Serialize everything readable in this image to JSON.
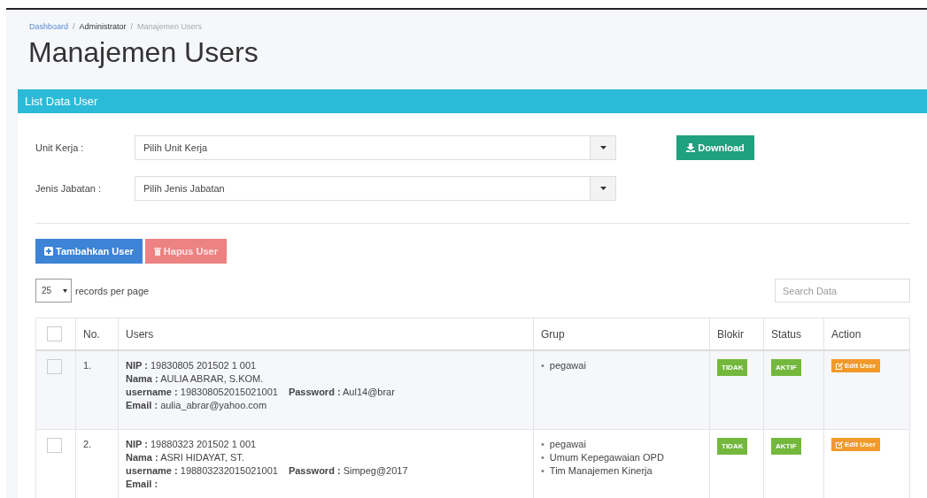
{
  "breadcrumb": {
    "separator": "/",
    "items": [
      {
        "label": "Dashboard",
        "kind": "link"
      },
      {
        "label": "Administrator",
        "kind": "text"
      },
      {
        "label": "Manajemen Users",
        "kind": "current"
      }
    ]
  },
  "title": "Manajemen Users",
  "panel": {
    "title": "List Data User",
    "filters": [
      {
        "label": "Unit Kerja :",
        "placeholder": "Pilih Unit Kerja"
      },
      {
        "label": "Jenis Jabatan :",
        "placeholder": "Pilih Jenis Jabatan"
      }
    ],
    "download_button": "Download",
    "add_button": "Tambahkan User",
    "delete_button": "Hapus User",
    "page_size": "25",
    "page_size_label": "records per page",
    "search": {
      "placeholder": "Search Data"
    },
    "table": {
      "bullet": "•",
      "header_checked": false,
      "columns": [
        "No.",
        "Users",
        "Grup",
        "Blokir",
        "Status",
        "Action"
      ],
      "rows": [
        {
          "checked": false,
          "no": "1.",
          "lines": [
            [
              "**NIP :** 19830805 201502 1 001"
            ],
            [
              "**Nama :** AULIA ABRAR, S.KOM."
            ],
            [
              "**username :** 198308052015021001",
              "**Password :** Aul14@brar"
            ],
            [
              "**Email :** aulia_abrar@yahoo.com"
            ]
          ],
          "groups": [
            "pegawai"
          ],
          "blokir": "TIDAK",
          "status": "AKTIF",
          "action": "Edit User"
        },
        {
          "checked": false,
          "no": "2.",
          "lines": [
            [
              "**NIP :** 19880323 201502 1 001"
            ],
            [
              "**Nama :** ASRI HIDAYAT, ST."
            ],
            [
              "**username :** 198803232015021001",
              "**Password :** Simpeg@2017"
            ],
            [
              "**Email :**"
            ]
          ],
          "groups": [
            "pegawai",
            "Umum Kepegawaian OPD",
            "Tim Manajemen Kinerja"
          ],
          "blokir": "TIDAK",
          "status": "AKTIF",
          "action": "Edit User"
        }
      ]
    }
  }
}
